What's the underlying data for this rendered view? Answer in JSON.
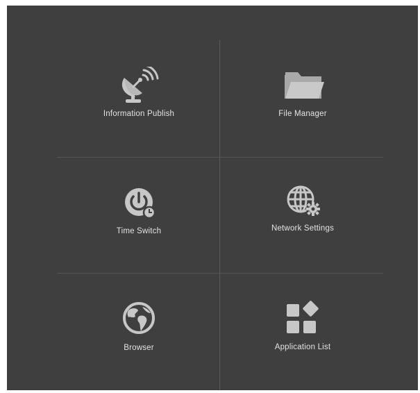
{
  "menu": {
    "items": [
      {
        "label": "Information Publish",
        "icon": "satellite-dish-icon"
      },
      {
        "label": "File Manager",
        "icon": "folder-icon"
      },
      {
        "label": "Time Switch",
        "icon": "power-timer-icon"
      },
      {
        "label": "Network Settings",
        "icon": "globe-gear-icon"
      },
      {
        "label": "Browser",
        "icon": "earth-icon"
      },
      {
        "label": "Application List",
        "icon": "app-grid-icon"
      }
    ]
  },
  "colors": {
    "background": "#3f3f3f",
    "icon": "#c7c7c7",
    "label": "#e3e3e3",
    "divider": "#555555"
  }
}
